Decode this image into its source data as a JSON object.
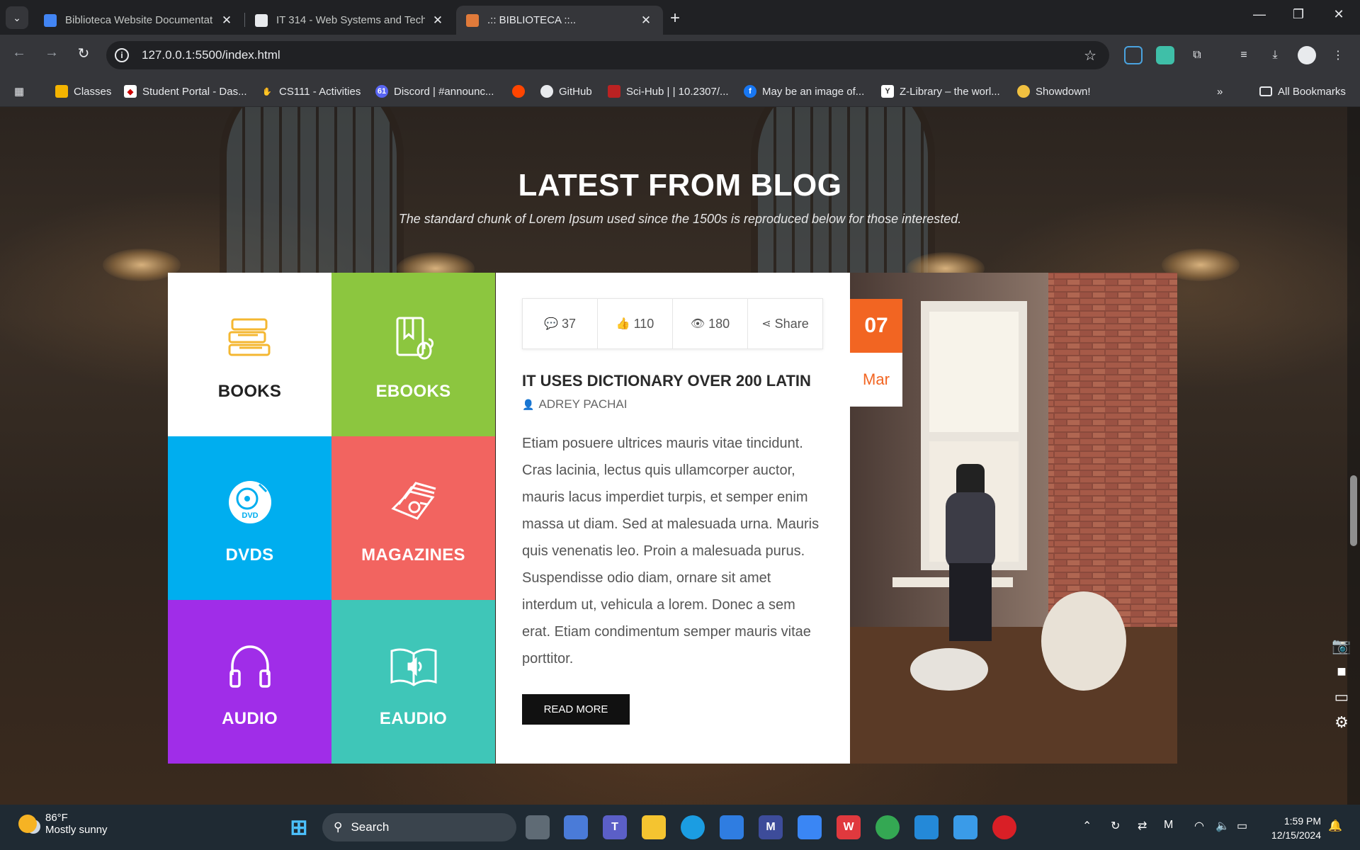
{
  "browser": {
    "tabs": [
      {
        "title": "Biblioteca Website Documentat",
        "active": false
      },
      {
        "title": "IT 314 - Web Systems and Techn",
        "active": false
      },
      {
        "title": ".:: BIBLIOTECA ::..",
        "active": true
      }
    ],
    "url": "127.0.0.1:5500/index.html",
    "bookmarks": [
      "Classes",
      "Student Portal - Das...",
      "CS111 - Activities",
      "Discord | #announc...",
      "GitHub",
      "Sci-Hub | | 10.2307/...",
      "May be an image of...",
      "Z-Library – the worl...",
      "Showdown!"
    ],
    "all_bookmarks": "All Bookmarks",
    "discord_badge": "61"
  },
  "section": {
    "title": "LATEST FROM BLOG",
    "subtitle": "The standard chunk of Lorem Ipsum used since the 1500s is reproduced below for those interested."
  },
  "categories": [
    {
      "label": "BOOKS",
      "icon": "books-icon",
      "color": "#ffffff",
      "text_color": "#222222"
    },
    {
      "label": "EBOOKS",
      "icon": "ebook-icon",
      "color": "#8cc63f",
      "text_color": "#ffffff"
    },
    {
      "label": "DVDS",
      "icon": "dvd-icon",
      "color": "#00aeef",
      "text_color": "#ffffff"
    },
    {
      "label": "MAGAZINES",
      "icon": "magazine-icon",
      "color": "#f26460",
      "text_color": "#ffffff"
    },
    {
      "label": "AUDIO",
      "icon": "headphones-icon",
      "color": "#a02de8",
      "text_color": "#ffffff"
    },
    {
      "label": "EAUDIO",
      "icon": "audiobook-icon",
      "color": "#3fc6b8",
      "text_color": "#ffffff"
    }
  ],
  "post": {
    "comments": "37",
    "likes": "110",
    "views": "180",
    "share": "Share",
    "title": "IT USES DICTIONARY OVER 200 LATIN",
    "author": "ADREY PACHAI",
    "body": "Etiam posuere ultrices mauris vitae tincidunt. Cras lacinia, lectus quis ullamcorper auctor, mauris lacus imperdiet turpis, et semper enim massa ut diam. Sed at malesuada urna. Mauris quis venenatis leo. Proin a malesuada purus. Suspendisse odio diam, ornare sit amet interdum ut, vehicula a lorem. Donec a sem erat. Etiam condimentum semper mauris vitae porttitor.",
    "read_more": "READ MORE",
    "date_day": "07",
    "date_month": "Mar",
    "accent_color": "#f26522"
  },
  "taskbar": {
    "temperature": "86°F",
    "weather": "Mostly sunny",
    "search": "Search",
    "time": "1:59 PM",
    "date": "12/15/2024"
  }
}
